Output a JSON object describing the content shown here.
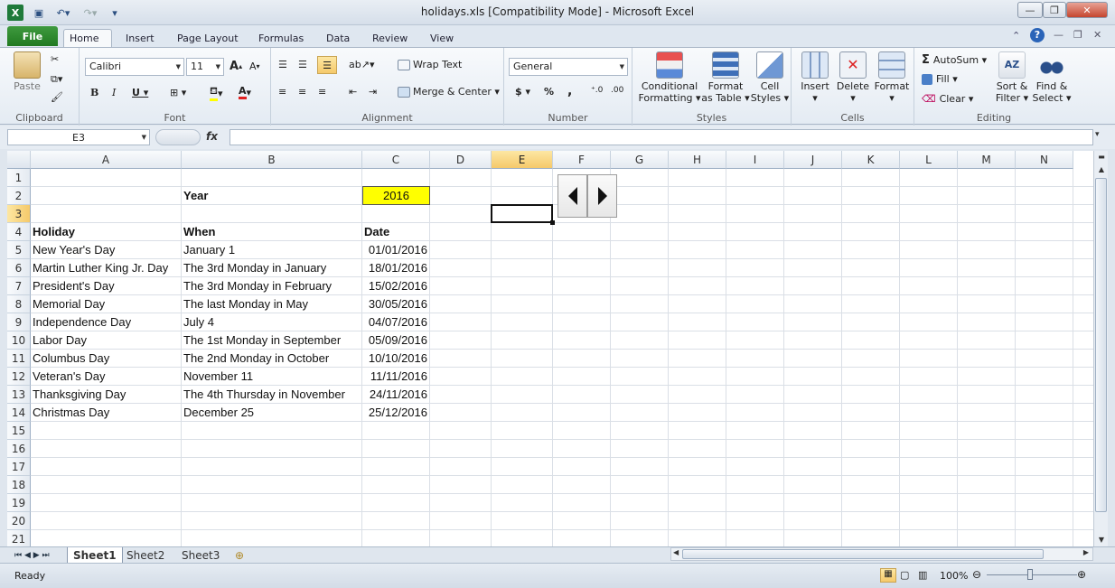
{
  "window": {
    "title": "holidays.xls  [Compatibility Mode]  -  Microsoft Excel"
  },
  "tabs": {
    "file": "File",
    "items": [
      "Home",
      "Insert",
      "Page Layout",
      "Formulas",
      "Data",
      "Review",
      "View"
    ],
    "active": "Home"
  },
  "ribbon": {
    "clipboard": {
      "label": "Clipboard",
      "paste": "Paste"
    },
    "font": {
      "label": "Font",
      "name": "Calibri",
      "size": "11"
    },
    "alignment": {
      "label": "Alignment",
      "wrap": "Wrap Text",
      "merge": "Merge & Center"
    },
    "number": {
      "label": "Number",
      "format": "General",
      "dollar": "$",
      "percent": "%",
      "comma": ","
    },
    "styles": {
      "label": "Styles",
      "conditional1": "Conditional",
      "conditional2": "Formatting",
      "format_table1": "Format",
      "format_table2": "as Table",
      "cell_styles1": "Cell",
      "cell_styles2": "Styles"
    },
    "cells": {
      "label": "Cells",
      "insert": "Insert",
      "delete": "Delete",
      "format": "Format"
    },
    "editing": {
      "label": "Editing",
      "autosum": "AutoSum",
      "fill": "Fill",
      "clear": "Clear",
      "sort1": "Sort &",
      "sort2": "Filter",
      "find1": "Find &",
      "find2": "Select"
    }
  },
  "formula_bar": {
    "name_box": "E3",
    "fx": "fx",
    "value": ""
  },
  "columns": [
    "A",
    "B",
    "C",
    "D",
    "E",
    "F",
    "G",
    "H",
    "I",
    "J",
    "K",
    "L",
    "M",
    "N"
  ],
  "rows": [
    "1",
    "2",
    "3",
    "4",
    "5",
    "6",
    "7",
    "8",
    "9",
    "10",
    "11",
    "12",
    "13",
    "14",
    "15",
    "16",
    "17",
    "18",
    "19",
    "20",
    "21"
  ],
  "cells": {
    "B2": "Year",
    "C2": "2016",
    "A4": "Holiday",
    "B4": "When",
    "C4": "Date",
    "holidays": [
      {
        "name": "New Year's Day",
        "when": "January 1",
        "date": "01/01/2016"
      },
      {
        "name": "Martin Luther King Jr. Day",
        "when": "The 3rd Monday in January",
        "date": "18/01/2016"
      },
      {
        "name": "President's Day",
        "when": "The 3rd Monday in February",
        "date": "15/02/2016"
      },
      {
        "name": "Memorial Day",
        "when": "The last Monday in May",
        "date": "30/05/2016"
      },
      {
        "name": "Independence Day",
        "when": "July 4",
        "date": "04/07/2016"
      },
      {
        "name": "Labor Day",
        "when": "The 1st Monday in September",
        "date": "05/09/2016"
      },
      {
        "name": "Columbus Day",
        "when": "The 2nd Monday in October",
        "date": "10/10/2016"
      },
      {
        "name": "Veteran's Day",
        "when": "November 11",
        "date": "11/11/2016"
      },
      {
        "name": "Thanksgiving Day",
        "when": "The 4th Thursday in November",
        "date": "24/11/2016"
      },
      {
        "name": "Christmas Day",
        "when": "December 25",
        "date": "25/12/2016"
      }
    ]
  },
  "sheets": [
    "Sheet1",
    "Sheet2",
    "Sheet3"
  ],
  "active_sheet": "Sheet1",
  "status": {
    "ready": "Ready",
    "zoom": "100%"
  },
  "colors": {
    "highlight": "#ffff00",
    "excel_green": "#217a21",
    "selected_header": "#f5c96a"
  }
}
